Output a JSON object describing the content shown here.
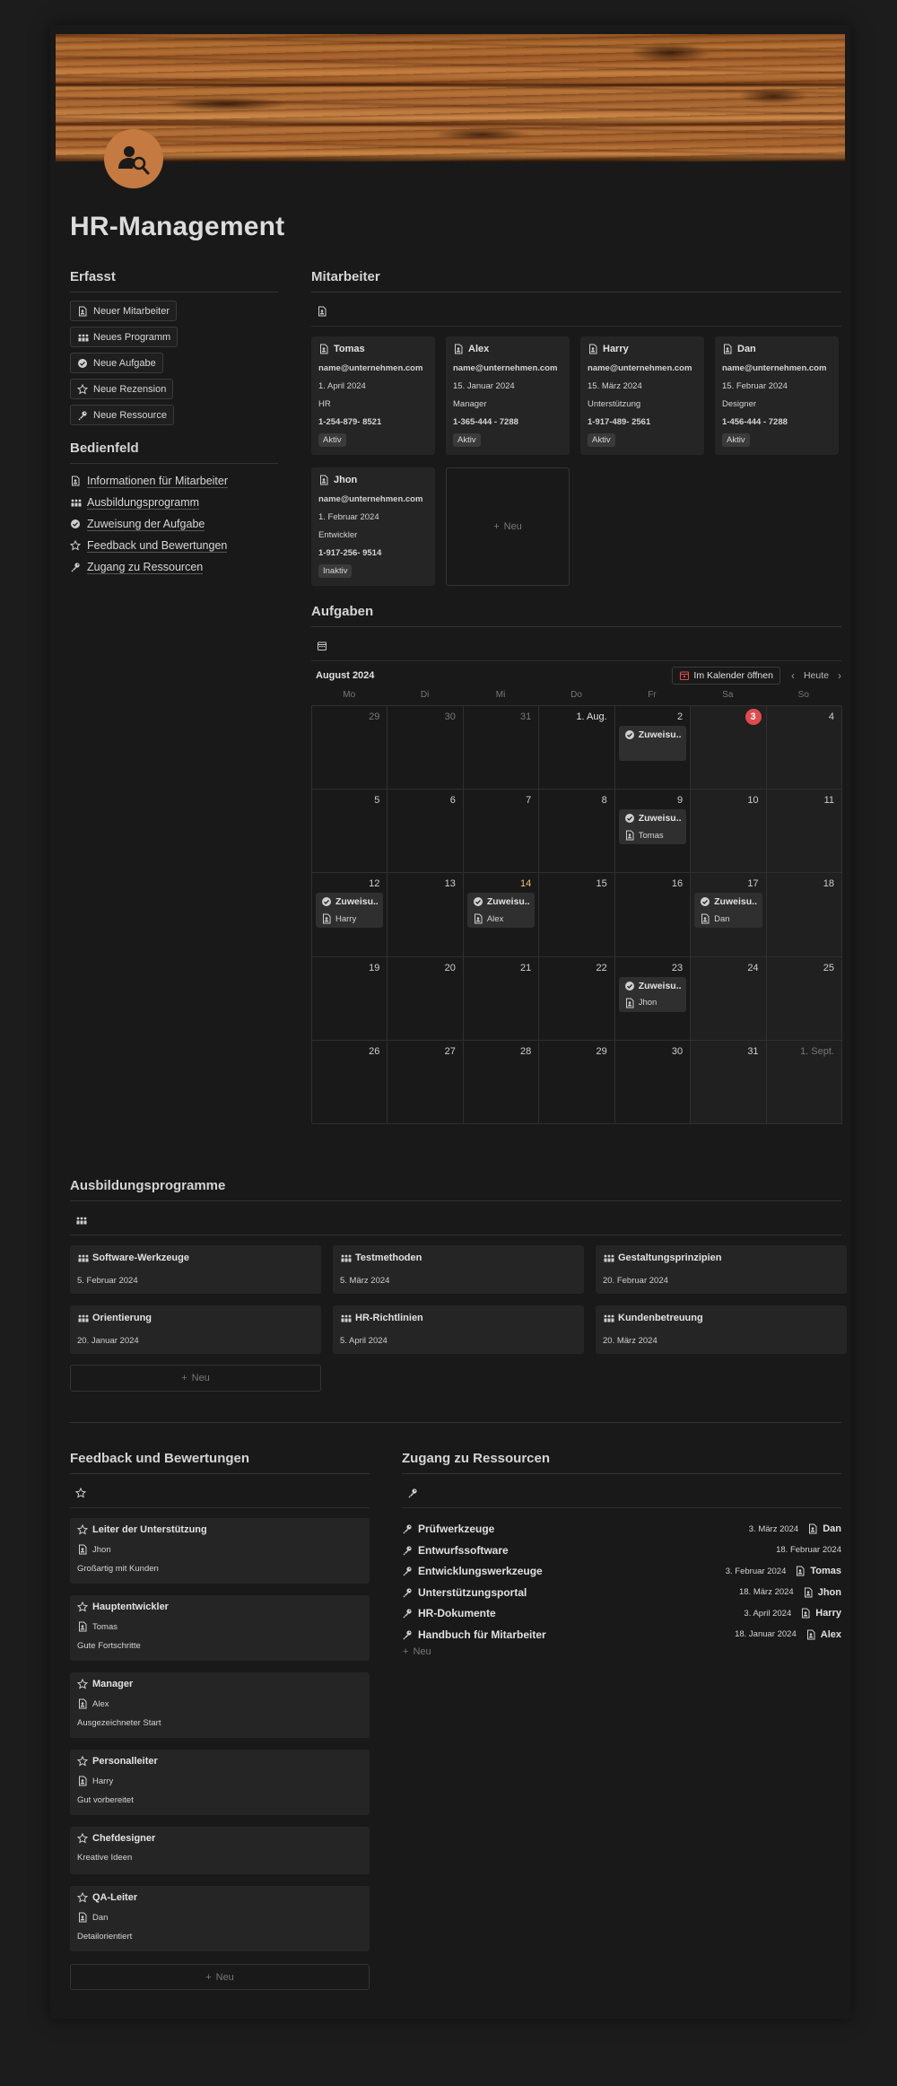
{
  "page": {
    "title": "HR-Management"
  },
  "erfasst": {
    "heading": "Erfasst",
    "buttons": [
      {
        "label": "Neuer Mitarbeiter",
        "icon": "document-person-icon"
      },
      {
        "label": "Neues Programm",
        "icon": "people-icon"
      },
      {
        "label": "Neue Aufgabe",
        "icon": "check-circle-icon"
      },
      {
        "label": "Neue Rezension",
        "icon": "star-icon"
      },
      {
        "label": "Neue Ressource",
        "icon": "key-icon"
      }
    ]
  },
  "bedienfeld": {
    "heading": "Bedienfeld",
    "links": [
      {
        "label": "Informationen für Mitarbeiter",
        "icon": "document-person-icon"
      },
      {
        "label": "Ausbildungsprogramm",
        "icon": "people-icon"
      },
      {
        "label": "Zuweisung der Aufgabe",
        "icon": "check-circle-icon"
      },
      {
        "label": "Feedback und Bewertungen",
        "icon": "star-icon"
      },
      {
        "label": "Zugang zu Ressourcen",
        "icon": "key-icon"
      }
    ]
  },
  "mitarbeiter": {
    "heading": "Mitarbeiter",
    "new_label": "Neu",
    "cards": [
      {
        "name": "Tomas",
        "email": "name@unternehmen.com",
        "date": "1. April 2024",
        "role": "HR",
        "phone": "1-254-879- 8521",
        "status": "Aktiv"
      },
      {
        "name": "Alex",
        "email": "name@unternehmen.com",
        "date": "15. Januar 2024",
        "role": "Manager",
        "phone": "1-365-444 - 7288",
        "status": "Aktiv"
      },
      {
        "name": "Harry",
        "email": "name@unternehmen.com",
        "date": "15. März 2024",
        "role": "Unterstützung",
        "phone": "1-917-489- 2561",
        "status": "Aktiv"
      },
      {
        "name": "Dan",
        "email": "name@unternehmen.com",
        "date": "15. Februar 2024",
        "role": "Designer",
        "phone": "1-456-444 - 7288",
        "status": "Aktiv"
      },
      {
        "name": "Jhon",
        "email": "name@unternehmen.com",
        "date": "1. Februar 2024",
        "role": "Entwickler",
        "phone": "1-917-256- 9514",
        "status": "Inaktiv"
      }
    ]
  },
  "aufgaben": {
    "heading": "Aufgaben",
    "month": "August 2024",
    "open_calendar": "Im Kalender öffnen",
    "today": "Heute",
    "weekdays": [
      "Mo",
      "Di",
      "Mi",
      "Do",
      "Fr",
      "Sa",
      "So"
    ],
    "days": [
      "29",
      "30",
      "31",
      "1. Aug.",
      "2",
      "3",
      "4",
      "5",
      "6",
      "7",
      "8",
      "9",
      "10",
      "11",
      "12",
      "13",
      "14",
      "15",
      "16",
      "17",
      "18",
      "19",
      "20",
      "21",
      "22",
      "23",
      "24",
      "25",
      "26",
      "27",
      "28",
      "29",
      "30",
      "31",
      "1. Sept."
    ],
    "events": [
      {
        "cell": 4,
        "title": "Zuweisu...",
        "person": ""
      },
      {
        "cell": 11,
        "title": "Zuweisu...",
        "person": "Tomas"
      },
      {
        "cell": 14,
        "title": "Zuweisu...",
        "person": "Harry"
      },
      {
        "cell": 16,
        "title": "Zuweisu...",
        "person": "Alex"
      },
      {
        "cell": 19,
        "title": "Zuweisu...",
        "person": "Dan"
      },
      {
        "cell": 25,
        "title": "Zuweisu...",
        "person": "Jhon"
      }
    ]
  },
  "ausbildung": {
    "heading": "Ausbildungsprogramme",
    "new_label": "Neu",
    "programs": [
      {
        "name": "Software-Werkzeuge",
        "date": "5. Februar 2024"
      },
      {
        "name": "Testmethoden",
        "date": "5. März 2024"
      },
      {
        "name": "Gestaltungsprinzipien",
        "date": "20. Februar 2024"
      },
      {
        "name": "Orientierung",
        "date": "20. Januar 2024"
      },
      {
        "name": "HR-Richtlinien",
        "date": "5. April 2024"
      },
      {
        "name": "Kundenbetreuung",
        "date": "20. März 2024"
      }
    ]
  },
  "feedback": {
    "heading": "Feedback und Bewertungen",
    "new_label": "Neu",
    "items": [
      {
        "title": "Leiter der Unterstützung",
        "person": "Jhon",
        "text": "Großartig mit Kunden"
      },
      {
        "title": "Hauptentwickler",
        "person": "Tomas",
        "text": "Gute Fortschritte"
      },
      {
        "title": "Manager",
        "person": "Alex",
        "text": "Ausgezeichneter Start"
      },
      {
        "title": "Personalleiter",
        "person": "Harry",
        "text": "Gut vorbereitet"
      },
      {
        "title": "Chefdesigner",
        "person": "",
        "text": "Kreative Ideen"
      },
      {
        "title": "QA-Leiter",
        "person": "Dan",
        "text": "Detailorientiert"
      }
    ]
  },
  "ressourcen": {
    "heading": "Zugang zu Ressourcen",
    "new_label": "Neu",
    "items": [
      {
        "name": "Prüfwerkzeuge",
        "date": "3. März 2024",
        "person": "Dan"
      },
      {
        "name": "Entwurfssoftware",
        "date": "18. Februar 2024",
        "person": ""
      },
      {
        "name": "Entwicklungswerkzeuge",
        "date": "3. Februar 2024",
        "person": "Tomas"
      },
      {
        "name": "Unterstützungsportal",
        "date": "18. März 2024",
        "person": "Jhon"
      },
      {
        "name": "HR-Dokumente",
        "date": "3. April 2024",
        "person": "Harry"
      },
      {
        "name": "Handbuch für Mitarbeiter",
        "date": "18. Januar 2024",
        "person": "Alex"
      }
    ]
  },
  "colors": {
    "today": "#e04b4b",
    "icon_bg": "#c47a40",
    "card_bg": "#252525"
  }
}
